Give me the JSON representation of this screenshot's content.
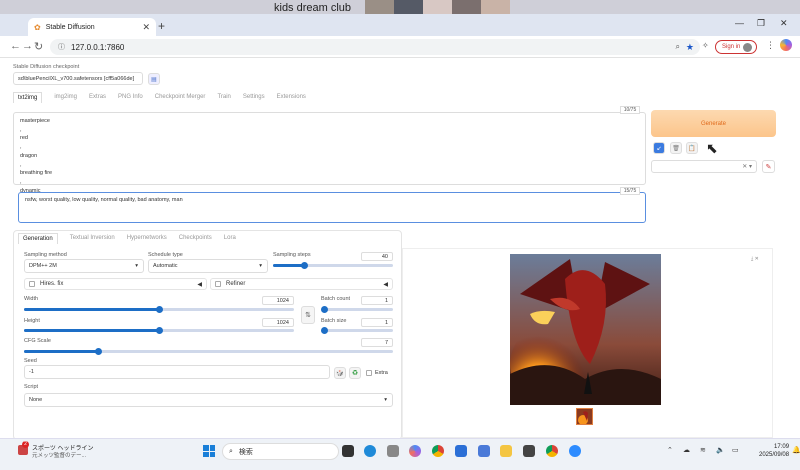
{
  "overlay": {
    "text": "kids dream club"
  },
  "browser": {
    "tab_title": "Stable Diffusion",
    "url": "127.0.0.1:7860",
    "signin_label": "Sign in"
  },
  "checkpoint": {
    "label": "Stable Diffusion checkpoint",
    "value": "sd\\bluePencilXL_v700.safetensors [cff5a066de]"
  },
  "main_tabs": [
    "txt2img",
    "img2img",
    "Extras",
    "PNG Info",
    "Checkpoint Merger",
    "Train",
    "Settings",
    "Extensions"
  ],
  "prompt": {
    "text": "masterpiece\n,\nred\n,\ndragon\n,\nbreathing fire\n,\ndynamic",
    "count": "10/75"
  },
  "negative_prompt": {
    "text": "nsfw, worst quality, low quality, normal quality, bad anatomy, man",
    "count": "15/75"
  },
  "generate_label": "Generate",
  "gen_tabs": [
    "Generation",
    "Textual Inversion",
    "Hypernetworks",
    "Checkpoints",
    "Lora"
  ],
  "settings": {
    "sampling_method_label": "Sampling method",
    "sampling_method": "DPM++ 2M",
    "schedule_type_label": "Schedule type",
    "schedule_type": "Automatic",
    "sampling_steps_label": "Sampling steps",
    "sampling_steps": "40",
    "hires_label": "Hires. fix",
    "refiner_label": "Refiner",
    "width_label": "Width",
    "width": "1024",
    "height_label": "Height",
    "height": "1024",
    "batch_count_label": "Batch count",
    "batch_count": "1",
    "batch_size_label": "Batch size",
    "batch_size": "1",
    "cfg_label": "CFG Scale",
    "cfg": "7",
    "seed_label": "Seed",
    "seed": "-1",
    "extra_label": "Extra",
    "script_label": "Script",
    "script": "None"
  },
  "levels": {
    "sampling_steps": 0.26,
    "width": 0.5,
    "height": 0.5,
    "batch_count": 0,
    "batch_size": 0,
    "cfg": 0.2
  },
  "taskbar": {
    "news_badge": "2",
    "news_title": "スポーツ ヘッドライン",
    "news_sub": "元メッツ監督のデー...",
    "search_label": "検索",
    "time": "17:09",
    "date": "2025/09/08"
  },
  "colors": {
    "accent": "#1d6ec6",
    "generate_text": "#e06a1a"
  }
}
